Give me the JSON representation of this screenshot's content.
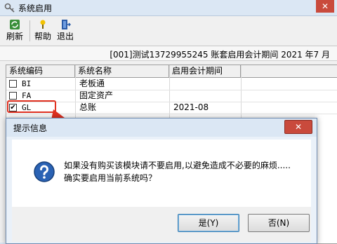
{
  "window": {
    "title": "系统启用",
    "close": "✕"
  },
  "toolbar": {
    "refresh": "刷新",
    "help": "帮助",
    "exit": "退出"
  },
  "info": {
    "account_text": "[001]测试13729955245 账套启用会计期间 2021 年7 月"
  },
  "table": {
    "headers": [
      "系统编码",
      "系统名称",
      "启用会计期间"
    ],
    "rows": [
      {
        "code": "BI",
        "name": "老板通",
        "period": "",
        "checked": false
      },
      {
        "code": "FA",
        "name": "固定资产",
        "period": "",
        "checked": false
      },
      {
        "code": "GL",
        "name": "总账",
        "period": "2021-08",
        "checked": true
      }
    ]
  },
  "dialog": {
    "title": "提示信息",
    "close": "✕",
    "message_line1": "如果没有购买该模块请不要启用,以避免造成不必要的麻烦.....",
    "message_line2": "确实要启用当前系统吗？",
    "yes": "是(Y)",
    "no": "否(N)"
  },
  "colors": {
    "annotation": "#e03020",
    "dialog_icon": "#2a62b4"
  }
}
